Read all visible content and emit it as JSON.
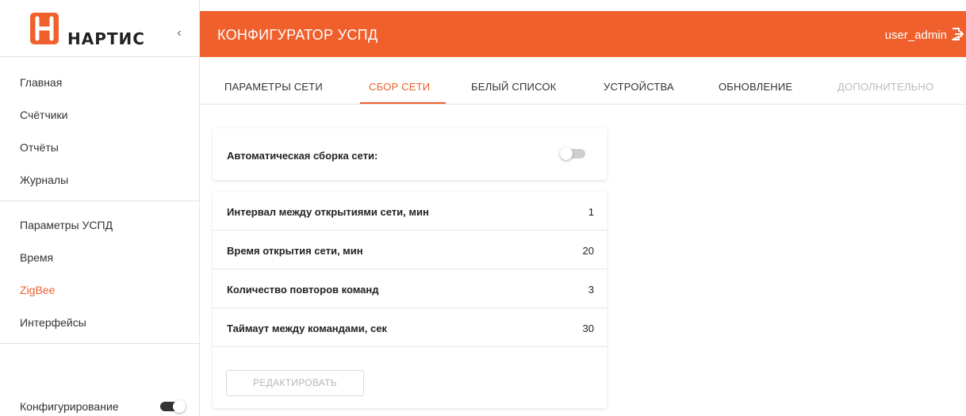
{
  "brand": {
    "name": "НАРТИС",
    "accent_color": "#f0602c"
  },
  "sidebar": {
    "collapse_icon": "chevron-left-icon",
    "group1": [
      {
        "label": "Главная"
      },
      {
        "label": "Счётчики"
      },
      {
        "label": "Отчёты"
      },
      {
        "label": "Журналы"
      }
    ],
    "group2": [
      {
        "label": "Параметры УСПД",
        "active": false
      },
      {
        "label": "Время",
        "active": false
      },
      {
        "label": "ZigBee",
        "active": true
      },
      {
        "label": "Интерфейсы",
        "active": false
      }
    ],
    "config_mode": {
      "label": "Конфигурирование",
      "enabled": true
    }
  },
  "header": {
    "title": "КОНФИГУРАТОР УСПД",
    "user": "user_admin",
    "logout_icon": "logout-icon"
  },
  "tabs": [
    {
      "label": "ПАРАМЕТРЫ СЕТИ",
      "state": "normal"
    },
    {
      "label": "СБОР СЕТИ",
      "state": "active"
    },
    {
      "label": "БЕЛЫЙ СПИСОК",
      "state": "normal"
    },
    {
      "label": "УСТРОЙСТВА",
      "state": "normal"
    },
    {
      "label": "ОБНОВЛЕНИЕ",
      "state": "normal"
    },
    {
      "label": "ДОПОЛНИТЕЛЬНО",
      "state": "disabled"
    }
  ],
  "auto_assembly": {
    "label": "Автоматическая сборка сети:",
    "enabled": false
  },
  "settings": [
    {
      "label": "Интервал между открытиями сети, мин",
      "value": "1"
    },
    {
      "label": "Время открытия сети, мин",
      "value": "20"
    },
    {
      "label": "Количество повторов команд",
      "value": "3"
    },
    {
      "label": "Таймаут между командами, сек",
      "value": "30"
    }
  ],
  "edit_button": {
    "label": "РЕДАКТИРОВАТЬ",
    "disabled": true
  }
}
